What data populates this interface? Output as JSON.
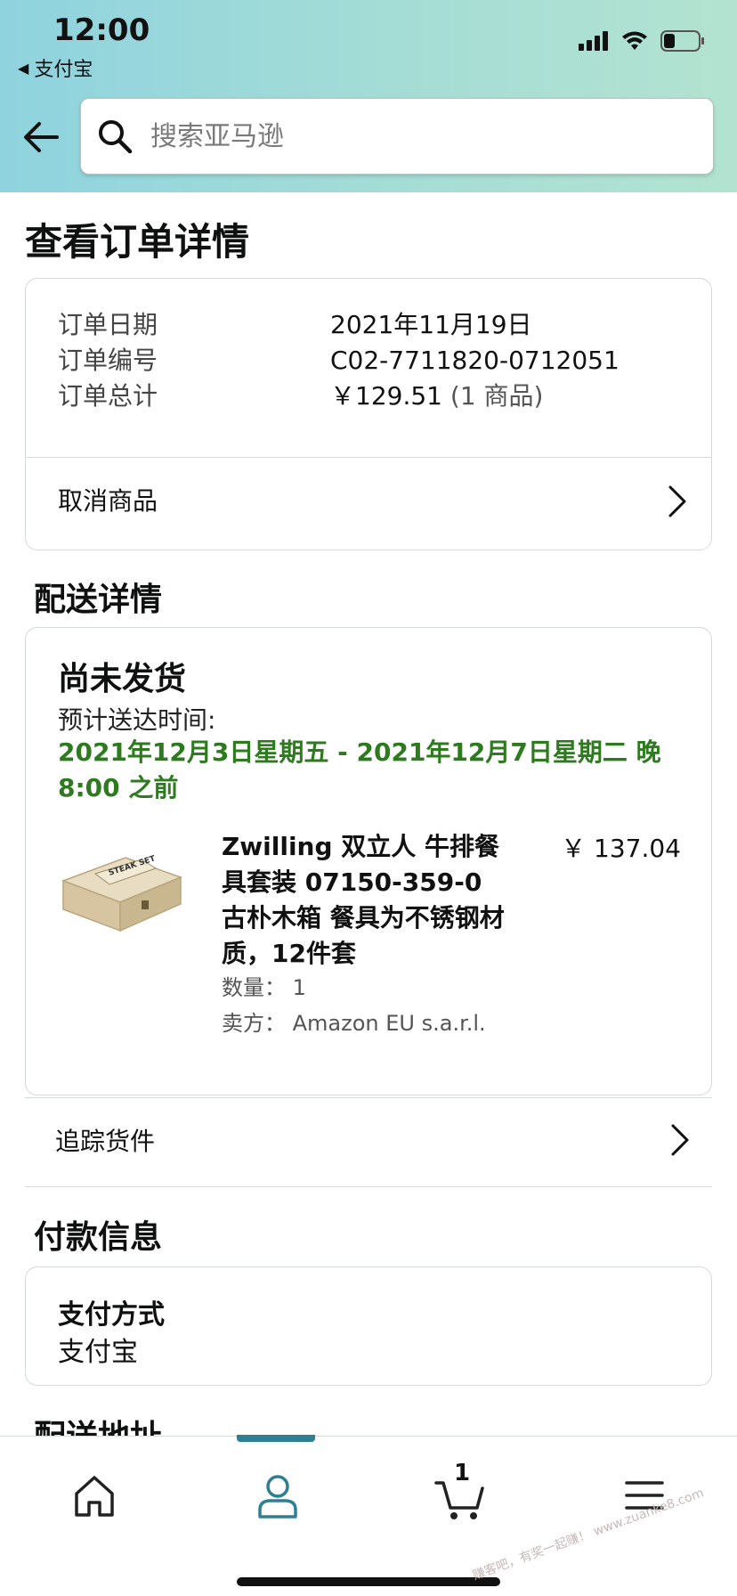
{
  "status_bar": {
    "time": "12:00",
    "back_app": "支付宝"
  },
  "search": {
    "placeholder": "搜索亚马逊"
  },
  "page_title": "查看订单详情",
  "order": {
    "date_label": "订单日期",
    "date_value": "2021年11月19日",
    "number_label": "订单编号",
    "number_value": "C02-7711820-0712051",
    "total_label": "订单总计",
    "total_value": "￥129.51",
    "total_items": "(1 商品)",
    "cancel_label": "取消商品"
  },
  "shipping": {
    "section_title": "配送详情",
    "status": "尚未发货",
    "eta_label": "预计送达时间:",
    "eta_value": "2021年12月3日星期五 - 2021年12月7日星期二 晚8:00 之前",
    "product": {
      "title": "Zwilling 双立人 牛排餐具套装 07150-359-0 古朴木箱 餐具为不锈钢材质，12件套",
      "price": "￥ 137.04",
      "quantity": "数量： 1",
      "seller": "卖方： Amazon EU s.a.r.l."
    },
    "track_label": "追踪货件"
  },
  "payment": {
    "section_title": "付款信息",
    "method_label": "支付方式",
    "method_value": "支付宝"
  },
  "address": {
    "section_title": "配送地址"
  },
  "tabbar": {
    "cart_count": "1",
    "accent_color": "#2f7f93"
  },
  "watermark": "赚客吧，有奖一起赚！ www.zuanke8.com"
}
